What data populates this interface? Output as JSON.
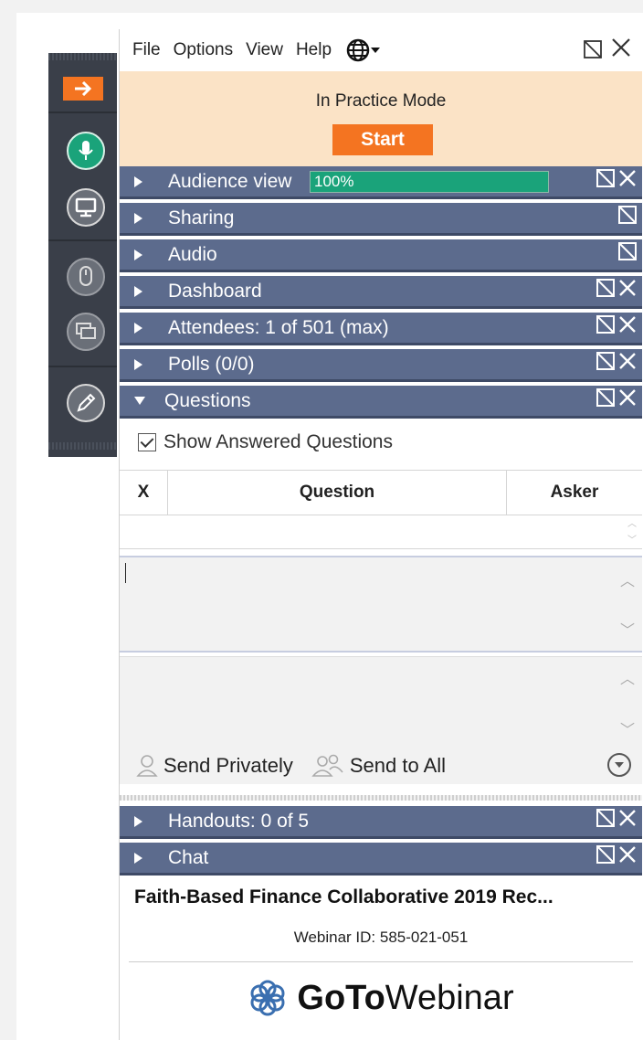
{
  "menu": {
    "file": "File",
    "options": "Options",
    "view": "View",
    "help": "Help"
  },
  "practice": {
    "status": "In Practice Mode",
    "start_label": "Start"
  },
  "panes": [
    {
      "key": "audience",
      "label": "Audience view",
      "meter": "100%",
      "open": false,
      "close": true
    },
    {
      "key": "sharing",
      "label": "Sharing",
      "open": false,
      "close": false
    },
    {
      "key": "audio",
      "label": "Audio",
      "open": false,
      "close": false
    },
    {
      "key": "dashboard",
      "label": "Dashboard",
      "open": false,
      "close": true
    },
    {
      "key": "attendees",
      "label": "Attendees:  1 of 501 (max)",
      "open": false,
      "close": true
    },
    {
      "key": "polls",
      "label": "Polls (0/0)",
      "open": false,
      "close": true
    },
    {
      "key": "questions",
      "label": "Questions",
      "open": true,
      "close": true
    }
  ],
  "questions": {
    "show_answered_label": "Show Answered Questions",
    "columns": [
      "X",
      "Question",
      "Asker"
    ],
    "send_privately": "Send Privately",
    "send_to_all": "Send to All"
  },
  "bottom_panes": [
    {
      "key": "handouts",
      "label": "Handouts: 0 of 5"
    },
    {
      "key": "chat",
      "label": "Chat"
    }
  ],
  "footer": {
    "webinar_title": "Faith-Based Finance Collaborative 2019 Rec...",
    "webinar_id": "Webinar ID: 585-021-051",
    "brand_goto": "GoTo",
    "brand_webinar": "Webinar"
  },
  "colors": {
    "accent_orange": "#f47421",
    "pane_header": "#5c6b8d",
    "practice_bg": "#fbe3c6",
    "mic_green": "#1aa37a",
    "toolbar": "#3a3f49"
  }
}
